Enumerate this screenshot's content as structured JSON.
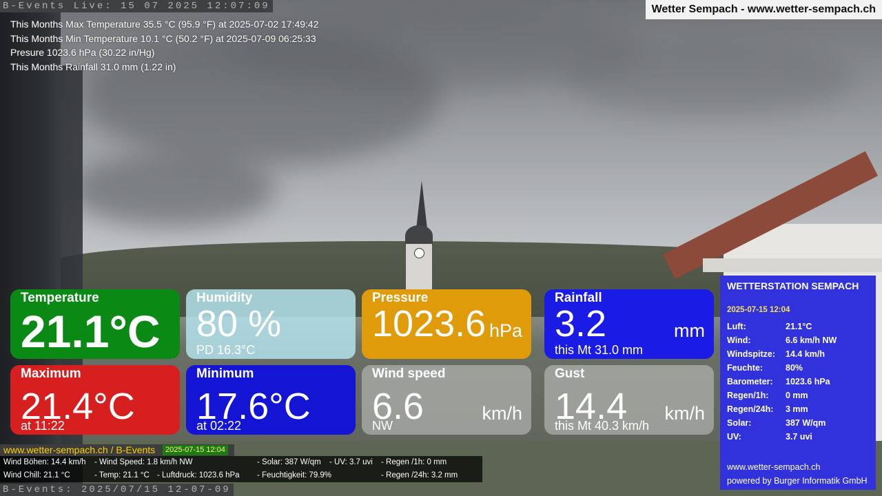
{
  "top_strip": "B-Events Live: 15 07 2025 12:07:09",
  "bottom_strip": "B-Events: 2025/07/15 12-07-09",
  "brand": "Wetter Sempach - www.wetter-sempach.ch",
  "stats": [
    "This Months Max Temperature 35.5 °C (95.9 °F) at 2025-07-02 17:49:42",
    "This Months Min Temperature 10.1 °C (50.2 °F) at 2025-07-09 06:25:33",
    "Presure 1023.6 hPa (30.22 in/Hg)",
    "This Months Rainfall 31.0 mm (1.22 in)"
  ],
  "tiles": {
    "temperature": {
      "label": "Temperature",
      "value": "21.1°C"
    },
    "humidity": {
      "label": "Humidity",
      "value": "80 %",
      "sub": "PD 16.3°C"
    },
    "pressure": {
      "label": "Pressure",
      "value": "1023.6",
      "unit": "hPa"
    },
    "rainfall": {
      "label": "Rainfall",
      "value": "3.2",
      "unit": "mm",
      "sub": "this Mt 31.0 mm"
    },
    "maximum": {
      "label": "Maximum",
      "value": "21.4°C",
      "sub": "at 11:22"
    },
    "minimum": {
      "label": "Minimum",
      "value": "17.6°C",
      "sub": "at 02:22"
    },
    "wind_speed": {
      "label": "Wind speed",
      "value": "6.6",
      "unit": "km/h",
      "sub": "NW"
    },
    "gust": {
      "label": "Gust",
      "value": "14.4",
      "unit": "km/h",
      "sub": "this Mt 40.3 km/h"
    }
  },
  "station": {
    "title": "WETTERSTATION SEMPACH",
    "date": "2025-07-15 12:04",
    "rows": [
      {
        "k": "Luft:",
        "v": "21.1°C"
      },
      {
        "k": "Wind:",
        "v": "6.6 km/h  NW"
      },
      {
        "k": "Windspitze:",
        "v": "14.4 km/h"
      },
      {
        "k": "Feuchte:",
        "v": "80%"
      },
      {
        "k": "Barometer:",
        "v": "1023.6 hPa"
      },
      {
        "k": "Regen/1h:",
        "v": "0 mm"
      },
      {
        "k": "Regen/24h:",
        "v": "3 mm"
      },
      {
        "k": "Solar:",
        "v": "387 W/qm"
      },
      {
        "k": "UV:",
        "v": "3.7 uvi"
      }
    ],
    "footer_url": "www.wetter-sempach.ch",
    "footer_powered": "powered by Burger Informatik GmbH"
  },
  "ticker": {
    "url": "www.wetter-sempach.ch / B-Events",
    "date": "2025-07-15 12:04",
    "line1": [
      "Wind Böhen: 14.4 km/h",
      "- Wind Speed: 1.8 km/h NW",
      "- Solar: 387 W/qm",
      "- UV: 3.7 uvi",
      "- Regen /1h:   0 mm"
    ],
    "line2": [
      "Wind Chill: 21.1 °C",
      "- Temp: 21.1 °C",
      "- Luftdruck: 1023.6 hPa",
      "- Feuchtigkeit: 79.9%",
      "- Regen /24h: 3.2 mm"
    ]
  }
}
